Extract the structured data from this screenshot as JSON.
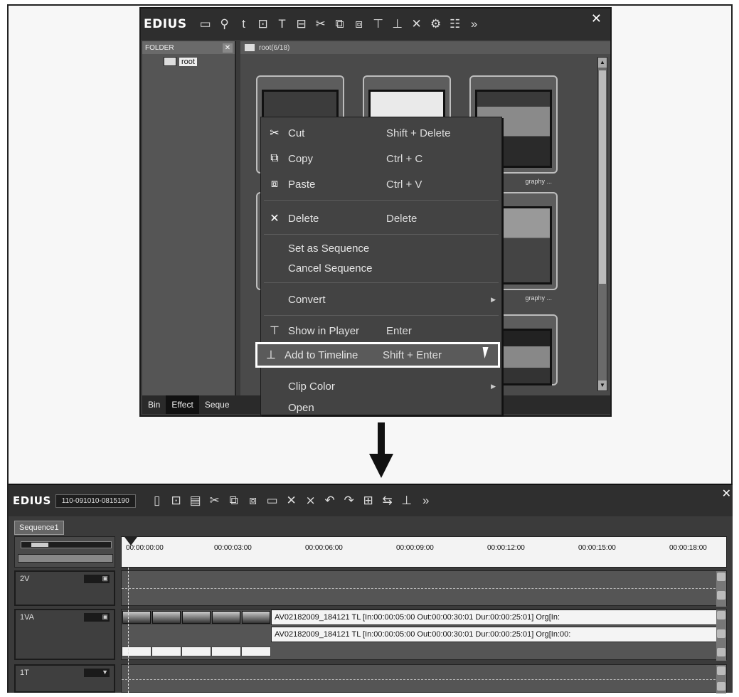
{
  "bin_window": {
    "logo": "EDIUS",
    "toolbar_icons": [
      "folder-icon",
      "search-icon",
      "t-icon",
      "add-clip-icon",
      "title-icon",
      "monitor-icon",
      "cut-icon",
      "copy-icon",
      "paste-icon",
      "show-player-icon",
      "add-timeline-icon",
      "delete-icon",
      "properties-icon",
      "view-icon",
      "more-icon"
    ],
    "folder_pane": {
      "header": "FOLDER",
      "root_label": "root"
    },
    "clip_pane": {
      "header": "root(6/18)"
    },
    "clip_captions": [
      "graphy ...",
      "graphy ..."
    ],
    "bottom_tabs": [
      "Bin",
      "Effect",
      "Seque"
    ]
  },
  "context_menu": {
    "items": [
      {
        "icon": "cut-icon",
        "label": "Cut",
        "shortcut": "Shift + Delete"
      },
      {
        "icon": "copy-icon",
        "label": "Copy",
        "shortcut": "Ctrl + C"
      },
      {
        "icon": "paste-icon",
        "label": "Paste",
        "shortcut": "Ctrl + V"
      },
      {
        "icon": "delete-icon",
        "label": "Delete",
        "shortcut": "Delete"
      },
      {
        "label": "Set as Sequence",
        "shortcut": ""
      },
      {
        "label": "Cancel Sequence",
        "shortcut": ""
      },
      {
        "label": "Convert",
        "shortcut": ""
      },
      {
        "icon": "show-player-icon",
        "label": "Show in Player",
        "shortcut": "Enter"
      },
      {
        "icon": "add-timeline-icon",
        "label": "Add to Timeline",
        "shortcut": "Shift + Enter"
      },
      {
        "label": "Clip Color",
        "shortcut": ""
      },
      {
        "label": "Open",
        "shortcut": ""
      }
    ],
    "highlighted": "Add to Timeline"
  },
  "timeline_window": {
    "logo": "EDIUS",
    "project_name": "110-091010-0815190",
    "toolbar_icons": [
      "new-icon",
      "add-clip-icon",
      "save-icon",
      "cut-icon",
      "copy-icon",
      "paste-icon",
      "link-icon",
      "delete-icon",
      "ripple-delete-icon",
      "undo-icon",
      "redo-icon",
      "insert-icon",
      "overwrite-icon",
      "add-timeline-icon",
      "more-icon"
    ],
    "sequence_tab": "Sequence1",
    "timecodes": [
      "00:00:00:00",
      "00:00:03:00",
      "00:00:06:00",
      "00:00:09:00",
      "00:00:12:00",
      "00:00:15:00",
      "00:00:18:00"
    ],
    "tracks": [
      {
        "name": "2V"
      },
      {
        "name": "1VA"
      },
      {
        "name": "1T"
      }
    ],
    "clip_video_text": "AV02182009_184121  TL [In:00:00:05:00 Out:00:00:30:01 Dur:00:00:25:01]  Org[In:",
    "clip_audio_text": "AV02182009_184121  TL [In:00:00:05:00 Out:00:00:30:01 Dur:00:00:25:01]  Org[In:00:"
  }
}
